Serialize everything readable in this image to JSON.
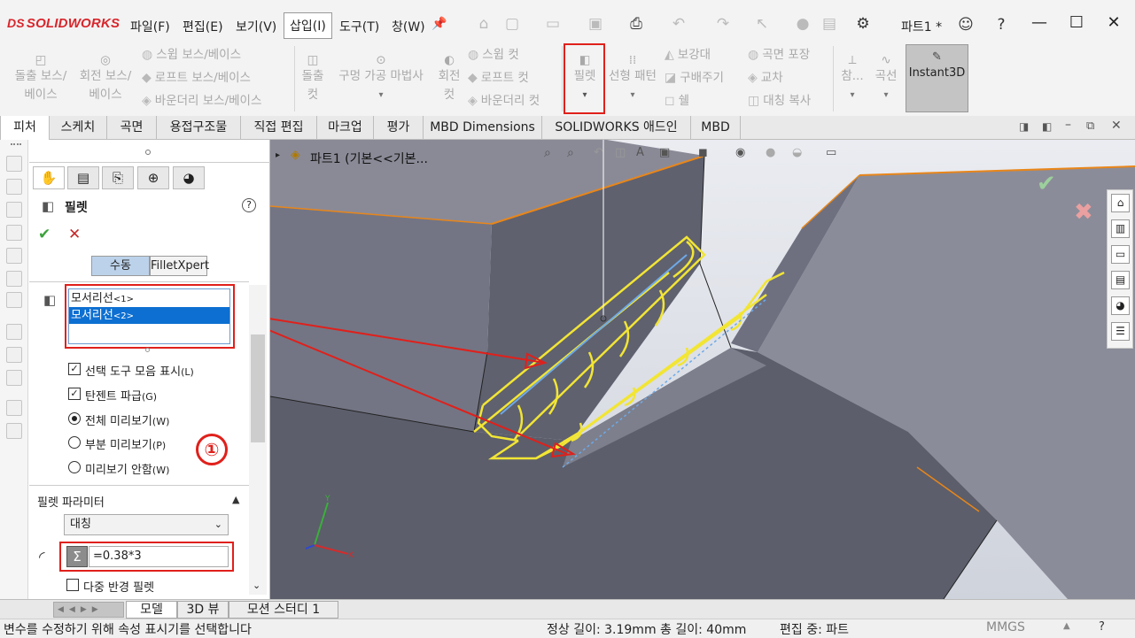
{
  "app": {
    "logo_text": "SOLIDWORKS",
    "logo_mark": "DS",
    "document_title": "파트1 *"
  },
  "menu": [
    "파일(F)",
    "편집(E)",
    "보기(V)",
    "삽입(I)",
    "도구(T)",
    "창(W)"
  ],
  "commands": {
    "extrude_boss": [
      "돌출 보스/",
      "베이스"
    ],
    "revolve_boss": [
      "회전 보스/",
      "베이스"
    ],
    "sweep_boss": "스윕 보스/베이스",
    "loft_boss": "로프트 보스/베이스",
    "boundary_boss": "바운더리 보스/베이스",
    "extrude_cut": [
      "돌출",
      "컷"
    ],
    "hole_wizard": [
      "구멍 가공 마법사"
    ],
    "revolve_cut": [
      "회전",
      "컷"
    ],
    "sweep_cut": "스윕 컷",
    "loft_cut": "로프트 컷",
    "boundary_cut": "바운더리 컷",
    "fillet": "필렛",
    "linear_pattern": "선형 패턴",
    "rib": "보강대",
    "draft": "구배주기",
    "shell": "쉘",
    "wrap": "곡면 포장",
    "intersect": "교차",
    "mirror": "대칭 복사",
    "reference": "참...",
    "curves": "곡선",
    "instant3d": "Instant3D"
  },
  "tabs": [
    "피처",
    "스케치",
    "곡면",
    "용접구조물",
    "직접 편집",
    "마크업",
    "평가",
    "MBD Dimensions",
    "SOLIDWORKS 애드인",
    "MBD"
  ],
  "active_tab": "피처",
  "property_manager": {
    "title": "필렛",
    "mode_manual": "수동",
    "mode_xpert": "FilletXpert",
    "edges": [
      {
        "label": "모서리선",
        "idx": "<1>"
      },
      {
        "label": "모서리선",
        "idx": "<2>"
      }
    ],
    "options": {
      "show_toolbar": "선택 도구 모음 표시",
      "show_toolbar_key": "(L)",
      "tangent": "탄젠트 파급",
      "tangent_key": "(G)",
      "full_preview": "전체 미리보기",
      "full_preview_key": "(W)",
      "partial_preview": "부분 미리보기",
      "partial_preview_key": "(P)",
      "no_preview": "미리보기 안함",
      "no_preview_key": "(W)"
    },
    "annotation_number": "①",
    "params_title": "필렛 파라미터",
    "fillet_type": "대칭",
    "radius_formula": "=0.38*3",
    "multi_radius": "다중 반경 필렛"
  },
  "viewport": {
    "tree_label": "파트1  (기본<<기본..."
  },
  "bottom_tabs": [
    "모델",
    "3D 뷰",
    "모션 스터디 1"
  ],
  "status": {
    "hint": "변수를 수정하기 위해 속성 표시기를 선택합니다",
    "measure": "정상 길이: 3.19mm 총 길이: 40mm",
    "edit_mode": "편집 중: 파트",
    "units": "MMGS"
  }
}
